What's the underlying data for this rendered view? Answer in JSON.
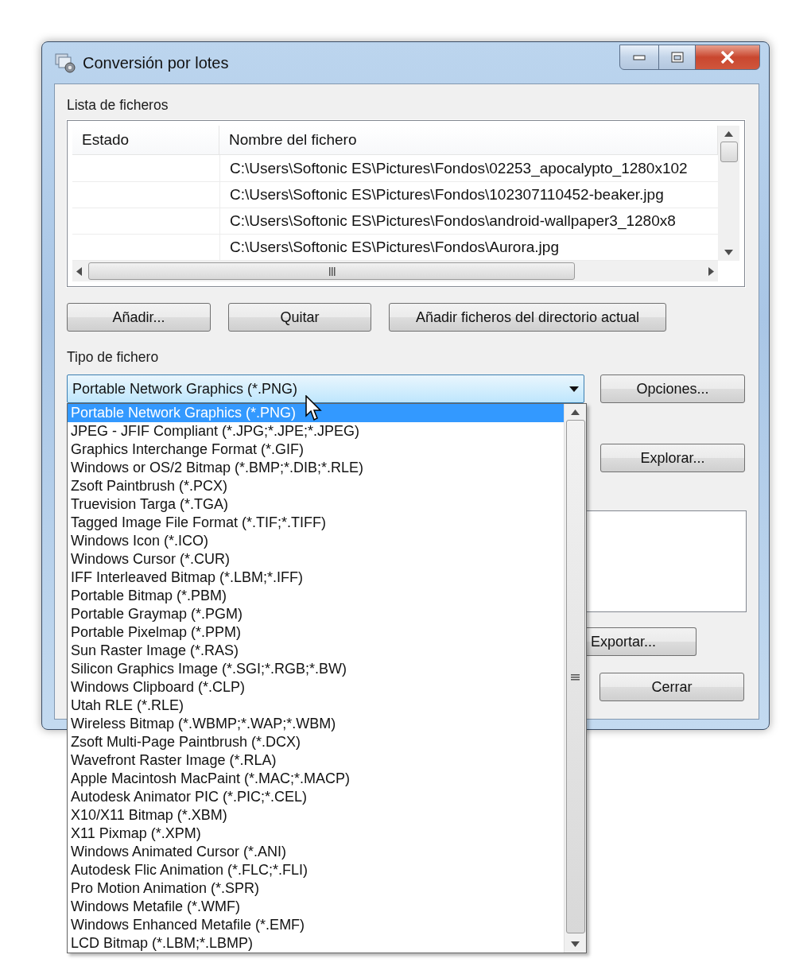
{
  "window": {
    "title": "Conversión por lotes"
  },
  "file_list": {
    "label": "Lista de ficheros",
    "columns": [
      "Estado",
      "Nombre del fichero"
    ],
    "rows": [
      {
        "file": "C:\\Users\\Softonic ES\\Pictures\\Fondos\\02253_apocalypto_1280x102"
      },
      {
        "file": "C:\\Users\\Softonic ES\\Pictures\\Fondos\\102307110452-beaker.jpg"
      },
      {
        "file": "C:\\Users\\Softonic ES\\Pictures\\Fondos\\android-wallpaper3_1280x8"
      },
      {
        "file": "C:\\Users\\Softonic ES\\Pictures\\Fondos\\Aurora.jpg"
      }
    ]
  },
  "list_buttons": [
    "Añadir...",
    "Quitar",
    "Añadir ficheros del directorio actual"
  ],
  "file_type": {
    "label": "Tipo de fichero",
    "value": "Portable Network Graphics (*.PNG)",
    "options": [
      {
        "label": "Portable Network Graphics (*.PNG)",
        "selected": true
      },
      {
        "label": "JPEG - JFIF Compliant (*.JPG;*.JPE;*.JPEG)",
        "selected": false
      },
      {
        "label": "Graphics Interchange Format (*.GIF)",
        "selected": false
      },
      {
        "label": "Windows or OS/2 Bitmap (*.BMP;*.DIB;*.RLE)",
        "selected": false
      },
      {
        "label": "Zsoft Paintbrush (*.PCX)",
        "selected": false
      },
      {
        "label": "Truevision Targa (*.TGA)",
        "selected": false
      },
      {
        "label": "Tagged Image File Format (*.TIF;*.TIFF)",
        "selected": false
      },
      {
        "label": "Windows Icon (*.ICO)",
        "selected": false
      },
      {
        "label": "Windows Cursor (*.CUR)",
        "selected": false
      },
      {
        "label": "IFF Interleaved Bitmap (*.LBM;*.IFF)",
        "selected": false
      },
      {
        "label": "Portable Bitmap (*.PBM)",
        "selected": false
      },
      {
        "label": "Portable Graymap (*.PGM)",
        "selected": false
      },
      {
        "label": "Portable Pixelmap (*.PPM)",
        "selected": false
      },
      {
        "label": "Sun Raster Image (*.RAS)",
        "selected": false
      },
      {
        "label": "Silicon Graphics Image (*.SGI;*.RGB;*.BW)",
        "selected": false
      },
      {
        "label": "Windows Clipboard (*.CLP)",
        "selected": false
      },
      {
        "label": "Utah RLE (*.RLE)",
        "selected": false
      },
      {
        "label": "Wireless Bitmap (*.WBMP;*.WAP;*.WBM)",
        "selected": false
      },
      {
        "label": "Zsoft Multi-Page Paintbrush (*.DCX)",
        "selected": false
      },
      {
        "label": "Wavefront Raster Image (*.RLA)",
        "selected": false
      },
      {
        "label": "Apple Macintosh MacPaint (*.MAC;*.MACP)",
        "selected": false
      },
      {
        "label": "Autodesk Animator PIC (*.PIC;*.CEL)",
        "selected": false
      },
      {
        "label": "X10/X11 Bitmap (*.XBM)",
        "selected": false
      },
      {
        "label": "X11 Pixmap (*.XPM)",
        "selected": false
      },
      {
        "label": "Windows Animated Cursor (*.ANI)",
        "selected": false
      },
      {
        "label": "Autodesk Flic Animation (*.FLC;*.FLI)",
        "selected": false
      },
      {
        "label": "Pro Motion Animation (*.SPR)",
        "selected": false
      },
      {
        "label": "Windows Metafile (*.WMF)",
        "selected": false
      },
      {
        "label": "Windows Enhanced Metafile (*.EMF)",
        "selected": false
      },
      {
        "label": "LCD Bitmap (*.LBM;*.LBMP)",
        "selected": false
      }
    ]
  },
  "side_buttons": {
    "options": "Opciones...",
    "browse": "Explorar...",
    "export": "Exportar...",
    "close": "Cerrar"
  }
}
